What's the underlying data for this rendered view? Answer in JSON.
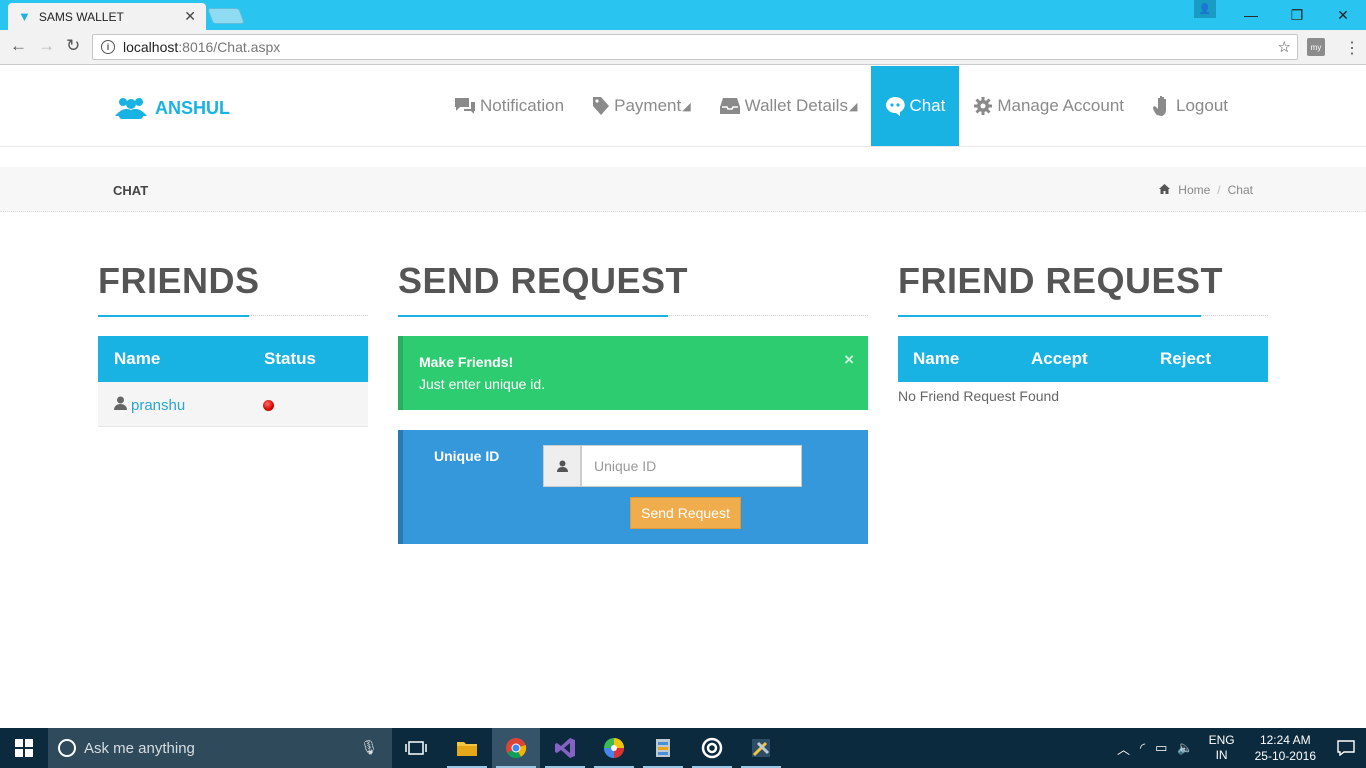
{
  "browser": {
    "tab_title": "SAMS WALLET",
    "url_host": "localhost",
    "url_path": ":8016/Chat.aspx"
  },
  "brand": {
    "name": "ANSHUL",
    "color": "#19b3e3"
  },
  "nav": {
    "notification": "Notification",
    "payment": "Payment",
    "wallet_details": "Wallet Details",
    "chat": "Chat",
    "manage_account": "Manage Account",
    "logout": "Logout",
    "active": "Chat"
  },
  "breadcrumb": {
    "page_title": "CHAT",
    "home": "Home",
    "current": "Chat"
  },
  "friends": {
    "title": "FRIENDS",
    "columns": [
      "Name",
      "Status"
    ],
    "rows": [
      {
        "name": "pranshu",
        "status": "offline"
      }
    ]
  },
  "send_request": {
    "title": "SEND REQUEST",
    "alert_title": "Make Friends!",
    "alert_message": "Just enter unique id.",
    "close_symbol": "×",
    "field_label": "Unique ID",
    "placeholder": "Unique ID",
    "button": "Send Request"
  },
  "friend_request": {
    "title": "FRIEND REQUEST",
    "columns": [
      "Name",
      "Accept",
      "Reject"
    ],
    "empty_message": "No Friend Request Found"
  },
  "taskbar": {
    "search_placeholder": "Ask me anything",
    "lang_top": "ENG",
    "lang_bottom": "IN",
    "time": "12:24 AM",
    "date": "25-10-2016"
  },
  "colors": {
    "primary": "#19b3e3",
    "success": "#2ecc71",
    "info": "#3498db",
    "warning": "#f0ad4e"
  }
}
